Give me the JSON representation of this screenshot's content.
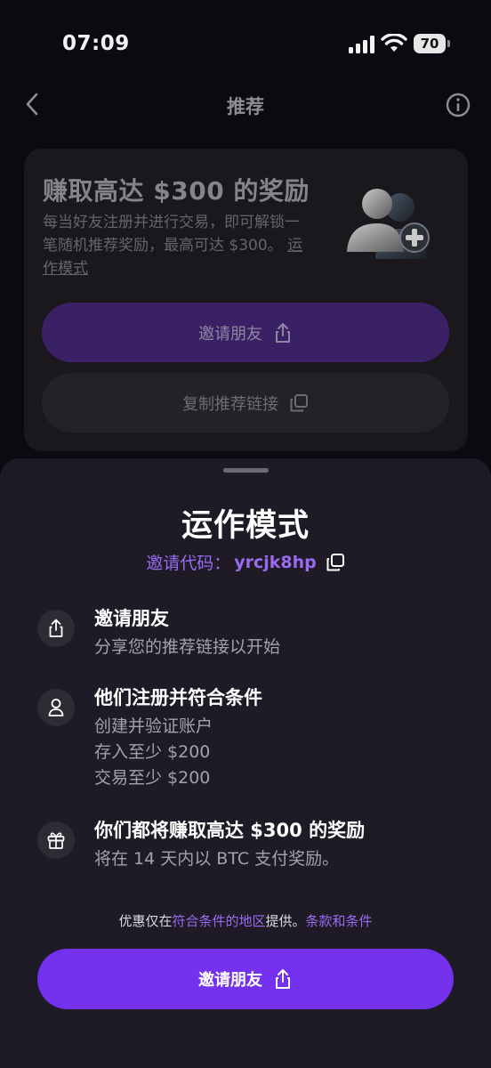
{
  "status": {
    "time": "07:09",
    "battery": "70"
  },
  "nav": {
    "title": "推荐"
  },
  "promo": {
    "title": "赚取高达 $300 的奖励",
    "desc_line1": "每当好友注册并进行交易，即可解锁一",
    "desc_line2_text": "笔随机推荐奖励，最高可达 $300。",
    "desc_link_a": "运",
    "desc_link_b": "作模式",
    "invite_label": "邀请朋友",
    "copy_label": "复制推荐链接"
  },
  "sheet": {
    "title": "运作模式",
    "code_label": "邀请代码：",
    "code_value": "yrcjk8hp",
    "steps": [
      {
        "icon": "share-icon",
        "title": "邀请朋友",
        "lines": [
          "分享您的推荐链接以开始"
        ]
      },
      {
        "icon": "user-icon",
        "title": "他们注册并符合条件",
        "lines": [
          "创建并验证账户",
          "存入至少 $200",
          "交易至少 $200"
        ]
      },
      {
        "icon": "gift-icon",
        "title": "你们都将赚取高达 $300 的奖励",
        "lines": [
          "将在 14 天内以 BTC 支付奖励。"
        ]
      }
    ],
    "footer": {
      "prefix": "优惠仅在",
      "region_link": "符合条件的地区",
      "mid": "提供。",
      "terms_link": "条款和条件"
    },
    "invite_button": "邀请朋友"
  },
  "colors": {
    "accent": "#7431ee",
    "link": "#9a6af0",
    "sheet_bg": "#1e1b26"
  }
}
